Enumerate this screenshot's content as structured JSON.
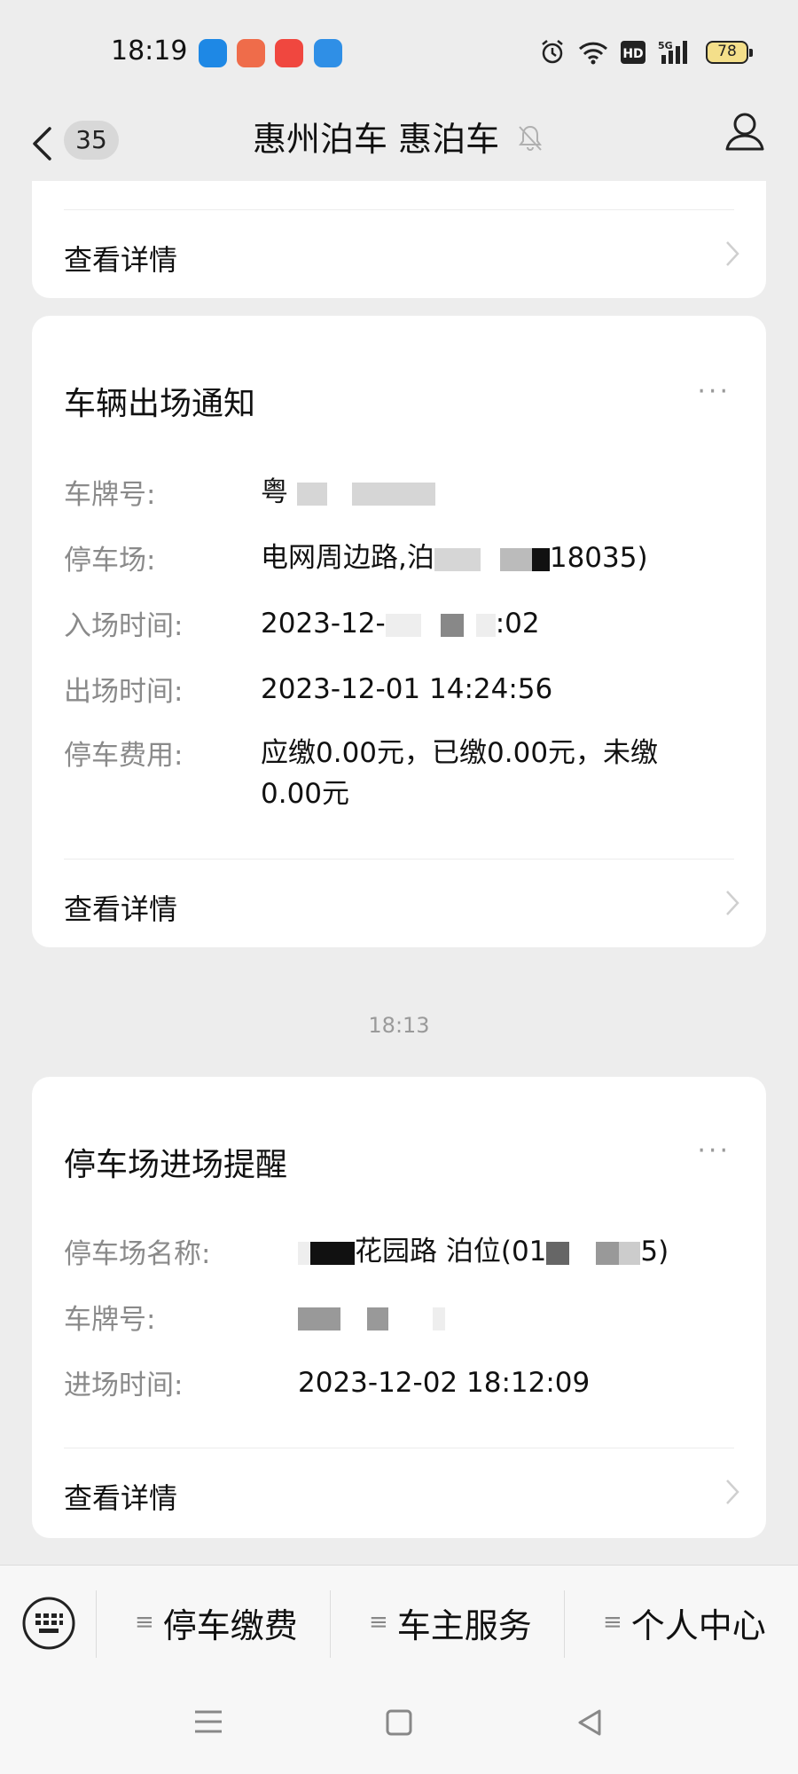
{
  "status_bar": {
    "time": "18:19",
    "battery": "78",
    "icons": [
      "app-1-icon",
      "app-2-icon",
      "app-3-icon",
      "app-4-icon",
      "alarm-icon",
      "wifi-icon",
      "hd-icon",
      "5g-signal-icon",
      "battery-icon"
    ]
  },
  "header": {
    "back_count": "35",
    "title": "惠州泊车 惠泊车"
  },
  "top_card": {
    "detail_label": "查看详情"
  },
  "exit_card": {
    "title": "车辆出场通知",
    "more": "···",
    "fields": [
      {
        "label": "车牌号:",
        "value": "粤"
      },
      {
        "label": "停车场:",
        "value_prefix": "电网周边路,泊",
        "value_suffix": "18035)"
      },
      {
        "label": "入场时间:",
        "value_prefix": "2023-12-",
        "value_suffix": ":02"
      },
      {
        "label": "出场时间:",
        "value": "2023-12-01 14:24:56"
      },
      {
        "label": "停车费用:",
        "value_line1": "应缴0.00元，已缴0.00元，未缴",
        "value_line2": "0.00元"
      }
    ],
    "detail_label": "查看详情"
  },
  "divider_time": "18:13",
  "entry_card": {
    "title": "停车场进场提醒",
    "more": "···",
    "fields": [
      {
        "label": "停车场名称:",
        "value_prefix": "花园路 泊位(01",
        "value_suffix": "5)"
      },
      {
        "label": "车牌号:",
        "value": ""
      },
      {
        "label": "进场时间:",
        "value": "2023-12-02 18:12:09"
      }
    ],
    "detail_label": "查看详情"
  },
  "bottom_menu": {
    "items": [
      {
        "label": "停车缴费"
      },
      {
        "label": "车主服务"
      },
      {
        "label": "个人中心"
      }
    ]
  },
  "colors": {
    "background": "#ededed",
    "card": "#ffffff",
    "label_gray": "#8a8a8a"
  }
}
